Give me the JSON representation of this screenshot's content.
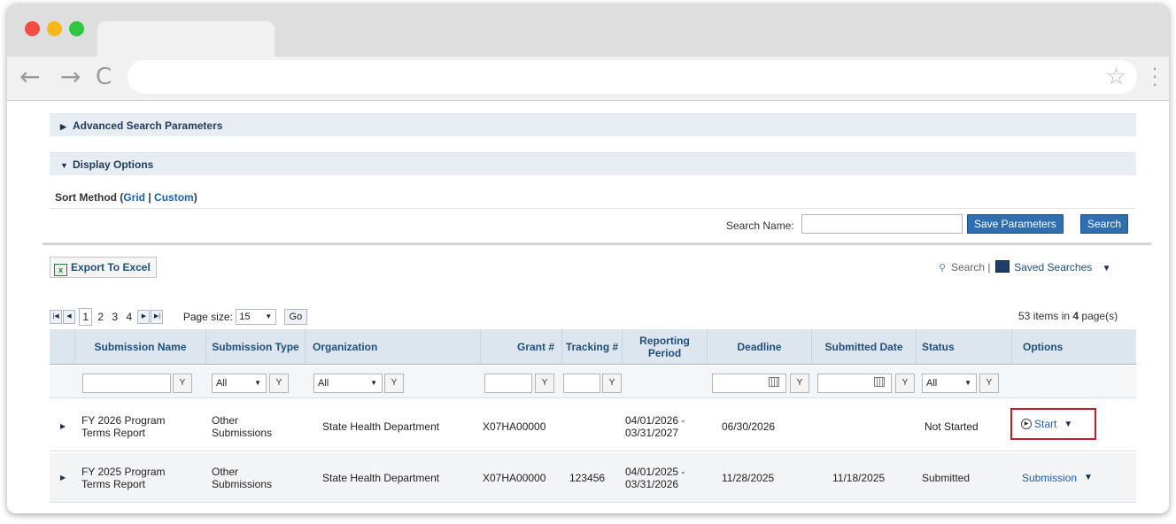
{
  "browser": {
    "back_icon": "←",
    "forward_icon": "→",
    "reload_icon": "C",
    "star_icon": "☆",
    "menu_icon": "⋮"
  },
  "panels": {
    "advanced_search": "Advanced Search Parameters",
    "display_options": "Display Options",
    "sort_method_prefix": "Sort Method (",
    "sort_grid": "Grid",
    "sort_sep": " | ",
    "sort_custom": "Custom",
    "sort_suffix": ")"
  },
  "search": {
    "name_label": "Search Name:",
    "name_value": "",
    "save_button": "Save Parameters",
    "search_button": "Search"
  },
  "toolbar": {
    "export_label": "Export To Excel",
    "search_link": "Search",
    "separator": "|",
    "saved_searches": "Saved Searches"
  },
  "pager": {
    "pages": [
      "1",
      "2",
      "3",
      "4"
    ],
    "current_page": "1",
    "page_size_label": "Page size:",
    "page_size_value": "15",
    "go_label": "Go",
    "items_count": "53",
    "items_text_mid": " items in ",
    "pages_count": "4",
    "items_text_end": " page(s)"
  },
  "grid": {
    "columns": [
      "Submission Name",
      "Submission Type",
      "Organization",
      "Grant #",
      "Tracking #",
      "Reporting Period",
      "Deadline",
      "Submitted Date",
      "Status",
      "Options"
    ],
    "filters": {
      "type_option": "All",
      "org_option": "All",
      "status_option": "All"
    },
    "rows": [
      {
        "name": "FY 2026 Program Terms Report",
        "type": "Other Submissions",
        "organization": "State Health Department",
        "grant": "X07HA00000",
        "tracking": "",
        "period": "04/01/2026 - 03/31/2027",
        "deadline": "06/30/2026",
        "submitted": "",
        "status": "Not Started",
        "option": "Start"
      },
      {
        "name": "FY 2025 Program Terms Report",
        "type": "Other Submissions",
        "organization": "State Health Department",
        "grant": "X07HA00000",
        "tracking": "123456",
        "period": "04/01/2025 - 03/31/2026",
        "deadline": "11/28/2025",
        "submitted": "11/18/2025",
        "status": "Submitted",
        "option": "Submission"
      }
    ]
  },
  "colors": {
    "accent_blue": "#2f6faf",
    "link_blue": "#1a5fa8",
    "highlight_red": "#c0202c",
    "header_bg": "#dde6ef"
  }
}
